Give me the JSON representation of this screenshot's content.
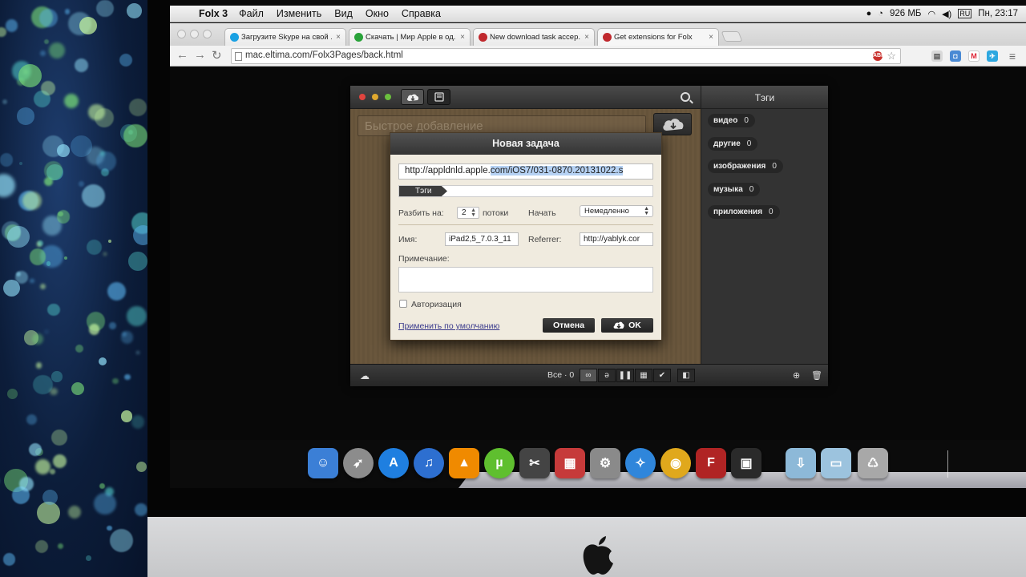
{
  "menubar": {
    "app_name": "Folx 3",
    "items": [
      "Файл",
      "Изменить",
      "Вид",
      "Окно",
      "Справка"
    ],
    "memory": "926 МБ",
    "keyboard": "RU",
    "clock": "Пн, 23:17"
  },
  "browser": {
    "tabs": [
      {
        "title": "Загрузите Skype на свой ...",
        "favicon": "skype-icon",
        "color": "#1aa1e3"
      },
      {
        "title": "Скачать | Мир Apple в од...",
        "favicon": "yablyk-icon",
        "color": "#2aa33a"
      },
      {
        "title": "New download task accep...",
        "favicon": "folx-icon",
        "color": "#c0282d"
      },
      {
        "title": "Get extensions for Folx",
        "favicon": "folx-icon",
        "color": "#c0282d"
      }
    ],
    "active_tab": 3,
    "address": "mac.eltima.com/Folx3Pages/back.html"
  },
  "folx": {
    "quick_add_placeholder": "Быстрое добавление",
    "tags_title": "Тэги",
    "tags": [
      {
        "label": "видео",
        "count": "0"
      },
      {
        "label": "другие",
        "count": "0"
      },
      {
        "label": "изображения",
        "count": "0"
      },
      {
        "label": "музыка",
        "count": "0"
      },
      {
        "label": "приложения",
        "count": "0"
      }
    ],
    "bottom_all": "Все · 0"
  },
  "dialog": {
    "title": "Новая задача",
    "url_plain": "http://appldnld.apple.",
    "url_selected": "com/iOS7/031-0870.20131022.s",
    "tags_label": "Тэги",
    "split_label": "Разбить на:",
    "split_value": "2",
    "threads_label": "потоки",
    "start_label": "Начать",
    "start_value": "Немедленно",
    "name_label": "Имя:",
    "name_value": "iPad2,5_7.0.3_11",
    "referrer_label": "Referrer:",
    "referrer_value": "http://yablyk.cor",
    "note_label": "Примечание:",
    "auth_label": "Авторизация",
    "defaults_link": "Применить по умолчанию",
    "cancel_label": "Отмена",
    "ok_label": "OK"
  },
  "dock": [
    {
      "name": "finder",
      "color": "#3b7fd6",
      "glyph": "☺"
    },
    {
      "name": "launchpad",
      "color": "#8c8c8c",
      "glyph": "➶"
    },
    {
      "name": "app-store",
      "color": "#1f7fe0",
      "glyph": "A"
    },
    {
      "name": "itunes",
      "color": "#2d6fd0",
      "glyph": "♫"
    },
    {
      "name": "vlc",
      "color": "#f08a00",
      "glyph": "▲"
    },
    {
      "name": "utorrent",
      "color": "#5fbf2f",
      "glyph": "µ"
    },
    {
      "name": "final-cut",
      "color": "#444",
      "glyph": "✂"
    },
    {
      "name": "photo-booth",
      "color": "#c63a3a",
      "glyph": "▦"
    },
    {
      "name": "system-preferences",
      "color": "#8a8a8a",
      "glyph": "⚙"
    },
    {
      "name": "safari",
      "color": "#2f86db",
      "glyph": "✧"
    },
    {
      "name": "chrome",
      "color": "#e0a81c",
      "glyph": "◉"
    },
    {
      "name": "folx",
      "color": "#b02424",
      "glyph": "F"
    },
    {
      "name": "photos",
      "color": "#2a2a2a",
      "glyph": "▣"
    },
    {
      "name": "downloads-stack",
      "color": "#8db9d8",
      "glyph": "⇩"
    },
    {
      "name": "documents-stack",
      "color": "#9cc3de",
      "glyph": "▭"
    },
    {
      "name": "trash",
      "color": "#a8a8a8",
      "glyph": "♺"
    }
  ]
}
